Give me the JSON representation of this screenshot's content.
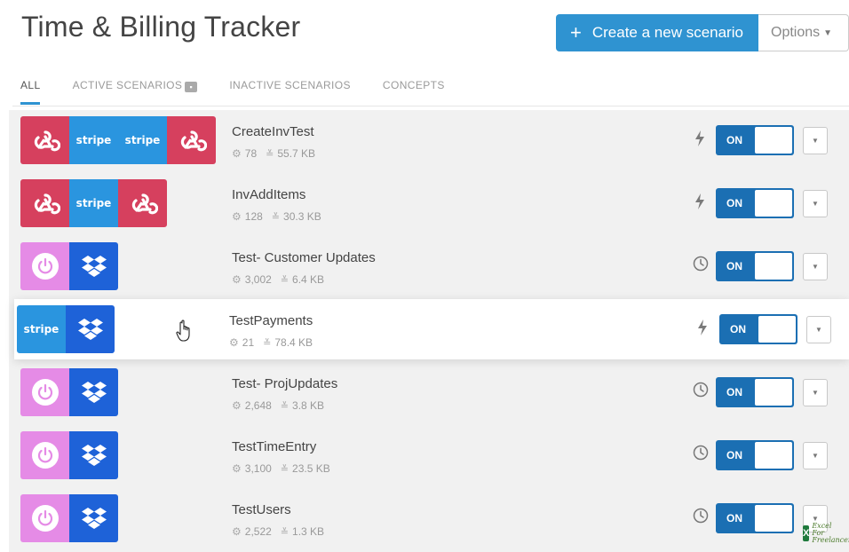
{
  "page": {
    "title": "Time & Billing Tracker"
  },
  "header": {
    "create_button_label": "Create a new scenario",
    "options_label": "Options"
  },
  "tabs": [
    {
      "label": "ALL",
      "active": true
    },
    {
      "label": "ACTIVE SCENARIOS",
      "active": false
    },
    {
      "label": "INACTIVE SCENARIOS",
      "active": false
    },
    {
      "label": "CONCEPTS",
      "active": false
    }
  ],
  "colors": {
    "accent": "#2f93d1",
    "toggle_on": "#1b6fb3",
    "webhook": "#d6405e",
    "stripe": "#2a95df",
    "timer": "#e58be6",
    "dropbox": "#1e62d8"
  },
  "scenarios": [
    {
      "name": "CreateInvTest",
      "operations": "78",
      "data_size": "55.7 KB",
      "modules": [
        "webhook-icon",
        "stripe-icon",
        "stripe-icon",
        "webhook-icon"
      ],
      "trigger": "instant-icon",
      "toggle_label": "ON"
    },
    {
      "name": "InvAddItems",
      "operations": "128",
      "data_size": "30.3 KB",
      "modules": [
        "webhook-icon",
        "stripe-icon",
        "webhook-icon"
      ],
      "trigger": "instant-icon",
      "toggle_label": "ON"
    },
    {
      "name": "Test- Customer Updates",
      "operations": "3,002",
      "data_size": "6.4 KB",
      "modules": [
        "power-icon",
        "dropbox-icon"
      ],
      "trigger": "clock-icon",
      "toggle_label": "ON"
    },
    {
      "name": "TestPayments",
      "operations": "21",
      "data_size": "78.4 KB",
      "modules": [
        "stripe-icon",
        "dropbox-icon"
      ],
      "trigger": "instant-icon",
      "toggle_label": "ON"
    },
    {
      "name": "Test- ProjUpdates",
      "operations": "2,648",
      "data_size": "3.8 KB",
      "modules": [
        "power-icon",
        "dropbox-icon"
      ],
      "trigger": "clock-icon",
      "toggle_label": "ON"
    },
    {
      "name": "TestTimeEntry",
      "operations": "3,100",
      "data_size": "23.5 KB",
      "modules": [
        "power-icon",
        "dropbox-icon"
      ],
      "trigger": "clock-icon",
      "toggle_label": "ON"
    },
    {
      "name": "TestUsers",
      "operations": "2,522",
      "data_size": "1.3 KB",
      "modules": [
        "power-icon",
        "dropbox-icon"
      ],
      "trigger": "clock-icon",
      "toggle_label": "ON"
    }
  ],
  "stripe_text": "stripe",
  "watermark": {
    "badge": "X",
    "line1": "Excel",
    "line2": "For",
    "line3": "Freelancers"
  }
}
